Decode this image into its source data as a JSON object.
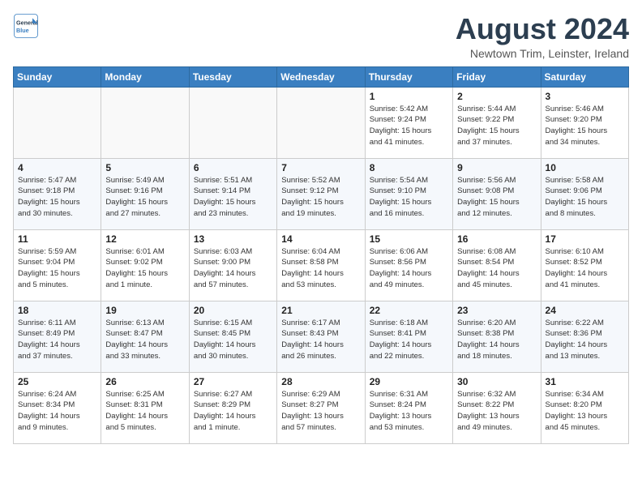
{
  "header": {
    "logo_general": "General",
    "logo_blue": "Blue",
    "month": "August 2024",
    "location": "Newtown Trim, Leinster, Ireland"
  },
  "days_of_week": [
    "Sunday",
    "Monday",
    "Tuesday",
    "Wednesday",
    "Thursday",
    "Friday",
    "Saturday"
  ],
  "weeks": [
    [
      {
        "day": "",
        "info": ""
      },
      {
        "day": "",
        "info": ""
      },
      {
        "day": "",
        "info": ""
      },
      {
        "day": "",
        "info": ""
      },
      {
        "day": "1",
        "info": "Sunrise: 5:42 AM\nSunset: 9:24 PM\nDaylight: 15 hours\nand 41 minutes."
      },
      {
        "day": "2",
        "info": "Sunrise: 5:44 AM\nSunset: 9:22 PM\nDaylight: 15 hours\nand 37 minutes."
      },
      {
        "day": "3",
        "info": "Sunrise: 5:46 AM\nSunset: 9:20 PM\nDaylight: 15 hours\nand 34 minutes."
      }
    ],
    [
      {
        "day": "4",
        "info": "Sunrise: 5:47 AM\nSunset: 9:18 PM\nDaylight: 15 hours\nand 30 minutes."
      },
      {
        "day": "5",
        "info": "Sunrise: 5:49 AM\nSunset: 9:16 PM\nDaylight: 15 hours\nand 27 minutes."
      },
      {
        "day": "6",
        "info": "Sunrise: 5:51 AM\nSunset: 9:14 PM\nDaylight: 15 hours\nand 23 minutes."
      },
      {
        "day": "7",
        "info": "Sunrise: 5:52 AM\nSunset: 9:12 PM\nDaylight: 15 hours\nand 19 minutes."
      },
      {
        "day": "8",
        "info": "Sunrise: 5:54 AM\nSunset: 9:10 PM\nDaylight: 15 hours\nand 16 minutes."
      },
      {
        "day": "9",
        "info": "Sunrise: 5:56 AM\nSunset: 9:08 PM\nDaylight: 15 hours\nand 12 minutes."
      },
      {
        "day": "10",
        "info": "Sunrise: 5:58 AM\nSunset: 9:06 PM\nDaylight: 15 hours\nand 8 minutes."
      }
    ],
    [
      {
        "day": "11",
        "info": "Sunrise: 5:59 AM\nSunset: 9:04 PM\nDaylight: 15 hours\nand 5 minutes."
      },
      {
        "day": "12",
        "info": "Sunrise: 6:01 AM\nSunset: 9:02 PM\nDaylight: 15 hours\nand 1 minute."
      },
      {
        "day": "13",
        "info": "Sunrise: 6:03 AM\nSunset: 9:00 PM\nDaylight: 14 hours\nand 57 minutes."
      },
      {
        "day": "14",
        "info": "Sunrise: 6:04 AM\nSunset: 8:58 PM\nDaylight: 14 hours\nand 53 minutes."
      },
      {
        "day": "15",
        "info": "Sunrise: 6:06 AM\nSunset: 8:56 PM\nDaylight: 14 hours\nand 49 minutes."
      },
      {
        "day": "16",
        "info": "Sunrise: 6:08 AM\nSunset: 8:54 PM\nDaylight: 14 hours\nand 45 minutes."
      },
      {
        "day": "17",
        "info": "Sunrise: 6:10 AM\nSunset: 8:52 PM\nDaylight: 14 hours\nand 41 minutes."
      }
    ],
    [
      {
        "day": "18",
        "info": "Sunrise: 6:11 AM\nSunset: 8:49 PM\nDaylight: 14 hours\nand 37 minutes."
      },
      {
        "day": "19",
        "info": "Sunrise: 6:13 AM\nSunset: 8:47 PM\nDaylight: 14 hours\nand 33 minutes."
      },
      {
        "day": "20",
        "info": "Sunrise: 6:15 AM\nSunset: 8:45 PM\nDaylight: 14 hours\nand 30 minutes."
      },
      {
        "day": "21",
        "info": "Sunrise: 6:17 AM\nSunset: 8:43 PM\nDaylight: 14 hours\nand 26 minutes."
      },
      {
        "day": "22",
        "info": "Sunrise: 6:18 AM\nSunset: 8:41 PM\nDaylight: 14 hours\nand 22 minutes."
      },
      {
        "day": "23",
        "info": "Sunrise: 6:20 AM\nSunset: 8:38 PM\nDaylight: 14 hours\nand 18 minutes."
      },
      {
        "day": "24",
        "info": "Sunrise: 6:22 AM\nSunset: 8:36 PM\nDaylight: 14 hours\nand 13 minutes."
      }
    ],
    [
      {
        "day": "25",
        "info": "Sunrise: 6:24 AM\nSunset: 8:34 PM\nDaylight: 14 hours\nand 9 minutes."
      },
      {
        "day": "26",
        "info": "Sunrise: 6:25 AM\nSunset: 8:31 PM\nDaylight: 14 hours\nand 5 minutes."
      },
      {
        "day": "27",
        "info": "Sunrise: 6:27 AM\nSunset: 8:29 PM\nDaylight: 14 hours\nand 1 minute."
      },
      {
        "day": "28",
        "info": "Sunrise: 6:29 AM\nSunset: 8:27 PM\nDaylight: 13 hours\nand 57 minutes."
      },
      {
        "day": "29",
        "info": "Sunrise: 6:31 AM\nSunset: 8:24 PM\nDaylight: 13 hours\nand 53 minutes."
      },
      {
        "day": "30",
        "info": "Sunrise: 6:32 AM\nSunset: 8:22 PM\nDaylight: 13 hours\nand 49 minutes."
      },
      {
        "day": "31",
        "info": "Sunrise: 6:34 AM\nSunset: 8:20 PM\nDaylight: 13 hours\nand 45 minutes."
      }
    ]
  ]
}
